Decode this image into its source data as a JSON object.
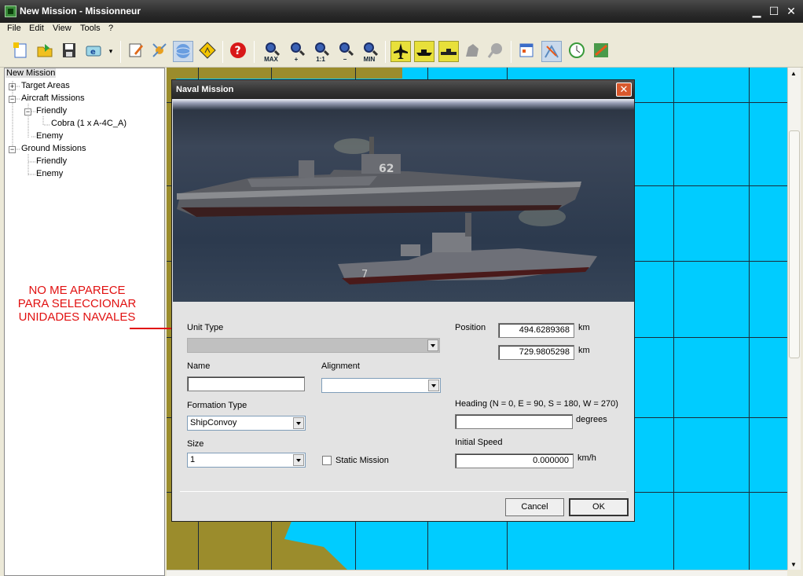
{
  "window": {
    "title": "New Mission - Missionneur",
    "minimize_glyph": "▁",
    "maximize_glyph": "☐",
    "close_glyph": "✕"
  },
  "menu": [
    "File",
    "Edit",
    "View",
    "Tools",
    "?"
  ],
  "toolbar": {
    "icons": [
      "new-file-icon",
      "open-icon",
      "save-icon",
      "print-icon",
      "edit-icon",
      "explosion-icon",
      "globe-icon",
      "road-sign-icon",
      "help-icon",
      "zoom-max-icon",
      "zoom-in-icon",
      "zoom-1to1-icon",
      "zoom-out-icon",
      "zoom-min-icon",
      "aircraft-icon",
      "ship-icon",
      "convoy-icon",
      "terrain-icon",
      "target-icon",
      "calendar-icon",
      "weather-icon",
      "clock-icon",
      "mission-icon"
    ],
    "zoom_labels": {
      "max": "MAX",
      "one": "1:1",
      "min": "MIN"
    }
  },
  "tree": {
    "root": "New Mission",
    "target_areas": "Target Areas",
    "aircraft_missions": "Aircraft Missions",
    "aircraft_friendly": "Friendly",
    "cobra": "Cobra (1 x A-4C_A)",
    "aircraft_enemy": "Enemy",
    "ground_missions": "Ground Missions",
    "ground_friendly": "Friendly",
    "ground_enemy": "Enemy"
  },
  "annotation": {
    "line1": "NO ME APARECE",
    "line2": "PARA SELECCIONAR",
    "line3": "UNIDADES NAVALES",
    "color": "#e11111"
  },
  "dialog": {
    "title": "Naval Mission",
    "close_glyph": "✕",
    "photo_labels": {
      "hull_number": "62",
      "frigate_number": "7"
    },
    "unit_type": {
      "label": "Unit Type",
      "value": ""
    },
    "position": {
      "label": "Position",
      "x": "494.6289368",
      "y": "729.9805298",
      "unit": "km"
    },
    "name": {
      "label": "Name",
      "value": ""
    },
    "alignment": {
      "label": "Alignment",
      "value": ""
    },
    "formation_type": {
      "label": "Formation Type",
      "value": "ShipConvoy"
    },
    "heading": {
      "label": "Heading (N = 0, E = 90, S = 180, W = 270)",
      "value": "",
      "unit": "degrees"
    },
    "size": {
      "label": "Size",
      "value": "1"
    },
    "static_mission": {
      "label": "Static Mission",
      "checked": false
    },
    "initial_speed": {
      "label": "Initial Speed",
      "value": "0.000000",
      "unit": "km/h"
    },
    "cancel": "Cancel",
    "ok": "OK"
  }
}
